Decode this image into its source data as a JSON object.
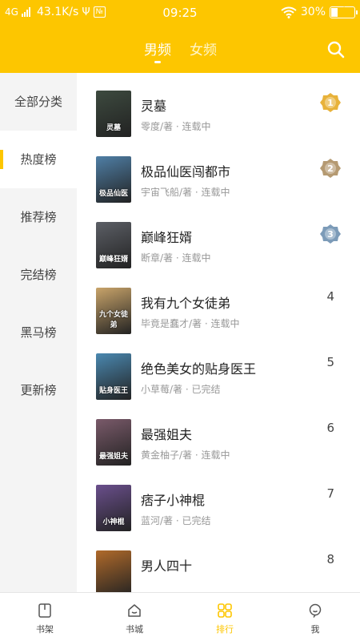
{
  "status_bar": {
    "network": "4G",
    "speed": "43.1K/s",
    "time": "09:25",
    "battery": "30%",
    "battery_level": 0.3
  },
  "header": {
    "tabs": [
      {
        "label": "男频",
        "active": true
      },
      {
        "label": "女频",
        "active": false
      }
    ],
    "search_icon": "search-icon",
    "background_color": "#fdc600"
  },
  "sidebar": {
    "items": [
      {
        "label": "全部分类",
        "active": false
      },
      {
        "label": "热度榜",
        "active": true
      },
      {
        "label": "推荐榜",
        "active": false
      },
      {
        "label": "完结榜",
        "active": false
      },
      {
        "label": "黑马榜",
        "active": false
      },
      {
        "label": "更新榜",
        "active": false
      }
    ]
  },
  "books": [
    {
      "rank": "1",
      "title": "灵墓",
      "author": "零度/著",
      "status": "连载中",
      "cover_text": "灵墓",
      "cover_color": "#3d4a3f",
      "medal_color": "#e8b23a"
    },
    {
      "rank": "2",
      "title": "极品仙医闯都市",
      "author": "宇宙飞船/著",
      "status": "连载中",
      "cover_text": "极品仙医",
      "cover_color": "#4f7fa6",
      "medal_color": "#b59a72"
    },
    {
      "rank": "3",
      "title": "巅峰狂婿",
      "author": "断章/著",
      "status": "连载中",
      "cover_text": "巅峰狂婿",
      "cover_color": "#5c5f66",
      "medal_color": "#7c9bb8"
    },
    {
      "rank": "4",
      "title": "我有九个女徒弟",
      "author": "毕竟是蠢才/著",
      "status": "连载中",
      "cover_text": "九个女徒弟",
      "cover_color": "#c9a46a"
    },
    {
      "rank": "5",
      "title": "绝色美女的贴身医王",
      "author": "小草莓/著",
      "status": "已完结",
      "cover_text": "贴身医王",
      "cover_color": "#4a88b0"
    },
    {
      "rank": "6",
      "title": "最强姐夫",
      "author": "黄金柚子/著",
      "status": "连载中",
      "cover_text": "最强姐夫",
      "cover_color": "#7a5a6a"
    },
    {
      "rank": "7",
      "title": "痞子小神棍",
      "author": "蓝河/著",
      "status": "已完结",
      "cover_text": "小神棍",
      "cover_color": "#6a4f8c"
    },
    {
      "rank": "8",
      "title": "男人四十",
      "author": "",
      "status": "",
      "cover_text": "",
      "cover_color": "#b06a2a"
    }
  ],
  "bottom_nav": [
    {
      "label": "书架",
      "icon": "bookshelf-icon",
      "active": false
    },
    {
      "label": "书城",
      "icon": "bookstore-icon",
      "active": false
    },
    {
      "label": "排行",
      "icon": "ranking-icon",
      "active": true
    },
    {
      "label": "我",
      "icon": "profile-icon",
      "active": false
    }
  ],
  "colors": {
    "accent": "#fdc600",
    "gold": "#e8b23a",
    "silver": "#b59a72",
    "bronze": "#7c9bb8"
  }
}
